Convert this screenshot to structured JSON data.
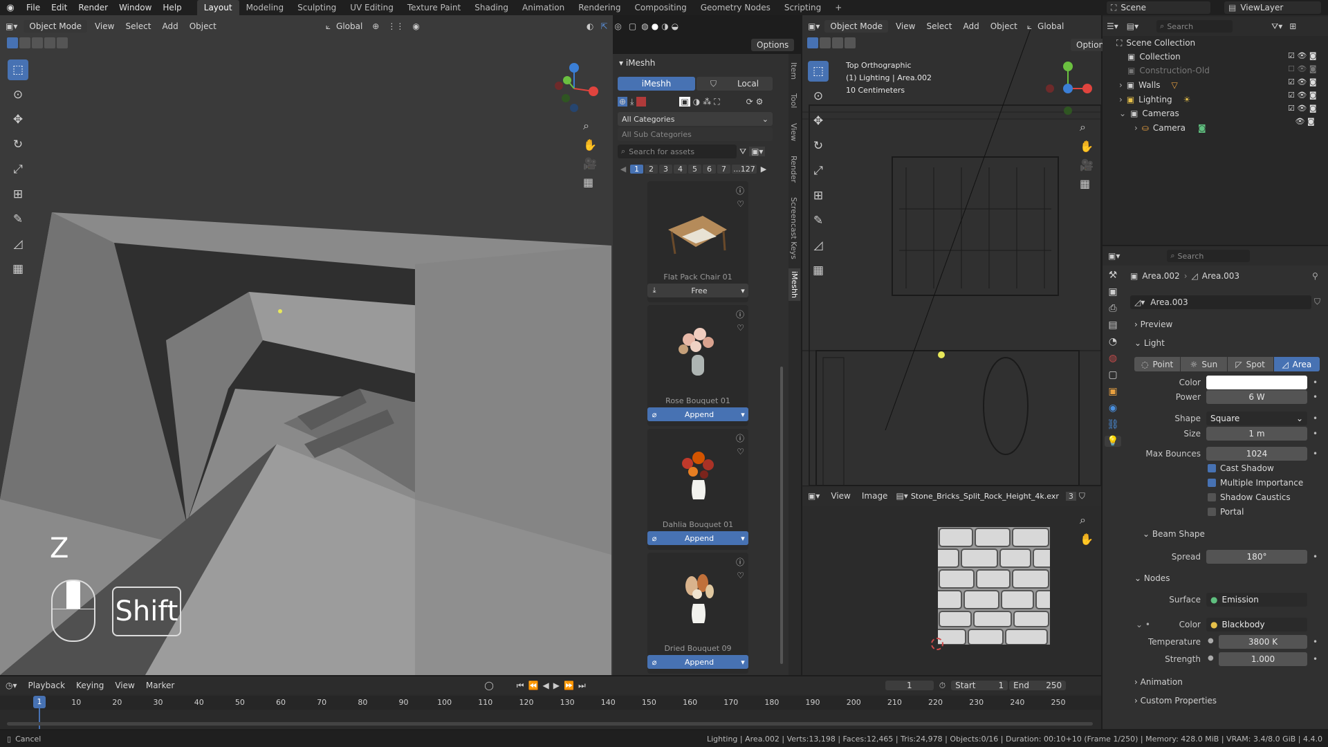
{
  "menubar": {
    "items": [
      "File",
      "Edit",
      "Render",
      "Window",
      "Help"
    ],
    "workspaces": [
      "Layout",
      "Modeling",
      "Sculpting",
      "UV Editing",
      "Texture Paint",
      "Shading",
      "Animation",
      "Rendering",
      "Compositing",
      "Geometry Nodes",
      "Scripting"
    ],
    "active_workspace": "Layout",
    "add_tab": "+",
    "scene": "Scene",
    "view_layer": "ViewLayer"
  },
  "left_viewport": {
    "mode": "Object Mode",
    "menus": [
      "View",
      "Select",
      "Add",
      "Object"
    ],
    "transform": "Global",
    "options": "Options",
    "key_z": "Z",
    "key_shift": "Shift"
  },
  "sidebar_tabs": [
    "Item",
    "Tool",
    "View",
    "Render",
    "Screencast Keys",
    "iMeshh"
  ],
  "imeshh": {
    "title": "iMeshh",
    "tab_imeshh": "iMeshh",
    "tab_local": "Local",
    "category": "All Categories",
    "sub_category": "All Sub Categories",
    "search_placeholder": "Search for assets",
    "pages": [
      "1",
      "2",
      "3",
      "4",
      "5",
      "6",
      "7",
      "...127"
    ],
    "assets": [
      {
        "name": "Flat Pack Chair 01",
        "button": "Free"
      },
      {
        "name": "Rose Bouquet 01",
        "button": "Append"
      },
      {
        "name": "Dahlia Bouquet 01",
        "button": "Append"
      },
      {
        "name": "Dried Bouquet 09",
        "button": "Append"
      }
    ]
  },
  "right_viewport": {
    "mode": "Object Mode",
    "menus": [
      "View",
      "Select",
      "Add",
      "Object"
    ],
    "transform": "Global",
    "options": "Options",
    "info_line1": "Top Orthographic",
    "info_line2": "(1) Lighting | Area.002",
    "info_line3": "10 Centimeters"
  },
  "image_editor": {
    "menus": [
      "View",
      "Image"
    ],
    "image_name": "Stone_Bricks_Split_Rock_Height_4k.exr",
    "users": "3"
  },
  "outliner": {
    "search_placeholder": "Search",
    "items": [
      "Scene Collection",
      "Collection",
      "Construction-Old",
      "Walls",
      "Lighting",
      "Cameras",
      "Camera"
    ]
  },
  "properties": {
    "search_placeholder": "Search",
    "breadcrumb_object": "Area.002",
    "breadcrumb_data": "Area.003",
    "datablock": "Area.003",
    "sections": {
      "preview": "Preview",
      "light": "Light",
      "beam_shape": "Beam Shape",
      "nodes": "Nodes",
      "animation": "Animation",
      "custom_properties": "Custom Properties"
    },
    "light_types": [
      "Point",
      "Sun",
      "Spot",
      "Area"
    ],
    "active_light_type": "Area",
    "labels": {
      "color": "Color",
      "power": "Power",
      "shape": "Shape",
      "size": "Size",
      "max_bounces": "Max Bounces",
      "spread": "Spread",
      "surface": "Surface",
      "node_color": "Color",
      "temperature": "Temperature",
      "strength": "Strength"
    },
    "values": {
      "color_hex": "#ffffff",
      "power": "6 W",
      "shape": "Square",
      "size": "1 m",
      "max_bounces": "1024",
      "spread": "180°",
      "surface": "Emission",
      "node_color": "Blackbody",
      "temperature": "3800 K",
      "strength": "1.000"
    },
    "checkboxes": [
      {
        "label": "Cast Shadow",
        "checked": true
      },
      {
        "label": "Multiple Importance",
        "checked": true
      },
      {
        "label": "Shadow Caustics",
        "checked": false
      },
      {
        "label": "Portal",
        "checked": false
      }
    ]
  },
  "timeline": {
    "menus": [
      "Playback",
      "Keying",
      "View",
      "Marker"
    ],
    "current_frame": "1",
    "start_label": "Start",
    "start": "1",
    "end_label": "End",
    "end": "250",
    "ticks": [
      "1",
      "10",
      "20",
      "30",
      "40",
      "50",
      "60",
      "70",
      "80",
      "90",
      "100",
      "110",
      "120",
      "130",
      "140",
      "150",
      "160",
      "170",
      "180",
      "190",
      "200",
      "210",
      "220",
      "230",
      "240",
      "250"
    ]
  },
  "statusbar": {
    "left": "Cancel",
    "right": "Lighting | Area.002 | Verts:13,198 | Faces:12,465 | Tris:24,978 | Objects:0/16 | Duration: 00:10+10 (Frame 1/250) | Memory: 428.0 MiB | VRAM: 3.4/8.0 GiB | 4.4.0"
  },
  "colors": {
    "accent": "#4772b3",
    "header": "#2c2c2c",
    "panel": "#303030",
    "lighting_collection": "#e6c04a"
  }
}
